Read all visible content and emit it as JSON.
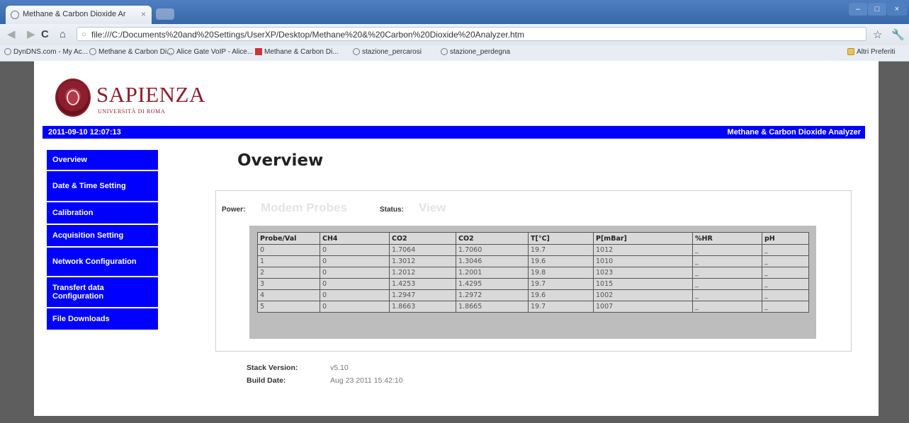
{
  "browser": {
    "tab_title": "Methane & Carbon Dioxide Ar",
    "address": "file:///C:/Documents%20and%20Settings/UserXP/Desktop/Methane%20&%20Carbon%20Dioxide%20Analyzer.htm",
    "bookmarks": [
      "DynDNS.com - My Ac...",
      "Methane & Carbon Di...",
      "Alice Gate VoIP - Alice...",
      "Methane & Carbon Di...",
      "stazione_percarosi",
      "stazione_perdegna"
    ],
    "other_bookmarks": "Altri Preferiti"
  },
  "header": {
    "logo_name": "SAPIENZA",
    "logo_sub": "UNIVERSITÀ DI ROMA",
    "datetime": "2011-09-10 12:07:13",
    "app_title": "Methane & Carbon Dioxide Analyzer"
  },
  "sidebar": {
    "items": [
      "Overview",
      "Date & Time Setting",
      "Calibration",
      "Acquisition Setting",
      "Network Configuration",
      "Transfert data Configuration",
      "File Downloads"
    ]
  },
  "main": {
    "heading": "Overview",
    "power_label": "Power:",
    "power_value": "Modem Probes",
    "status_label": "Status:",
    "status_value": "View",
    "table": {
      "headers": [
        "Probe/Val",
        "CH4",
        "CO2",
        "CO2",
        "T[°C]",
        "P[mBar]",
        "%HR",
        "pH"
      ],
      "rows": [
        [
          "0",
          "0",
          "1.7064",
          "1.7060",
          "19.7",
          "1012",
          "_",
          "_"
        ],
        [
          "1",
          "0",
          "1.3012",
          "1.3046",
          "19.6",
          "1010",
          "_",
          "_"
        ],
        [
          "2",
          "0",
          "1.2012",
          "1.2001",
          "19.8",
          "1023",
          "_",
          "_"
        ],
        [
          "3",
          "0",
          "1.4253",
          "1.4295",
          "19.7",
          "1015",
          "_",
          "_"
        ],
        [
          "4",
          "0",
          "1.2947",
          "1.2972",
          "19.6",
          "1002",
          "_",
          "_"
        ],
        [
          "5",
          "0",
          "1.8663",
          "1.8665",
          "19.7",
          "1007",
          "_",
          "_"
        ]
      ]
    }
  },
  "footer": {
    "stack_label": "Stack Version:",
    "stack_value": "v5.10",
    "build_label": "Build Date:",
    "build_value": "Aug 23 2011 15:42:10"
  },
  "colors": {
    "nav_blue": "#0000ff",
    "sapienza_red": "#8c1f2d"
  }
}
